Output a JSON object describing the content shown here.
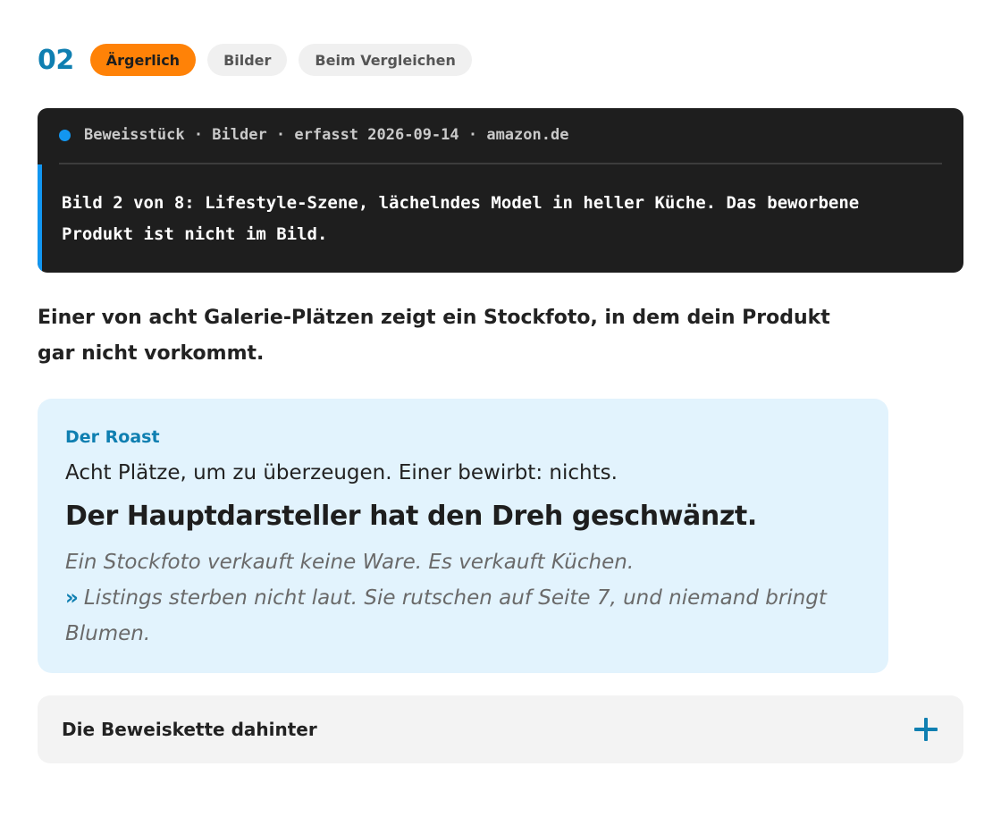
{
  "finding": {
    "number": "02",
    "tags": {
      "severity": "Ärgerlich",
      "category": "Bilder",
      "context": "Beim Vergleichen"
    }
  },
  "evidence": {
    "meta": "Beweisstück · Bilder · erfasst 2026-09-14 · amazon.de",
    "body": "Bild 2 von 8: Lifestyle-Szene, lächelndes Model in heller Küche. Das beworbene Produkt ist nicht im Bild.",
    "accent_color": "#1296f0"
  },
  "lead": "Einer von acht Galerie-Plätzen zeigt ein Stockfoto, in dem dein Produkt gar nicht vorkommt.",
  "roast": {
    "label": "Der Roast",
    "subline": "Acht Plätze, um zu überzeugen. Einer bewirbt: nichts.",
    "headline": "Der Hauptdarsteller hat den Dreh geschwänzt.",
    "line1": "Ein Stockfoto verkauft keine Ware. Es verkauft Küchen.",
    "quote_mark": "»",
    "line2": "Listings sterben nicht laut. Sie rutschen auf Seite 7, und niemand bringt Blumen."
  },
  "accordion": {
    "title": "Die Beweiskette dahinter",
    "icon": "plus-icon"
  },
  "colors": {
    "brand_blue": "#0f7fb1",
    "severity_orange": "#ff8207",
    "evidence_bg": "#1e1e1e",
    "roast_bg": "#e2f3fd"
  }
}
